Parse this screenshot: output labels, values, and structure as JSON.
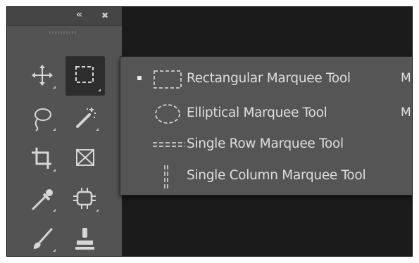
{
  "header": {
    "collapse_glyph": "«",
    "close_glyph": "✖"
  },
  "tools": [
    {
      "icon": "move-icon"
    },
    {
      "icon": "rectangular-marquee-icon",
      "active": true
    },
    {
      "icon": "lasso-icon"
    },
    {
      "icon": "magic-wand-icon"
    },
    {
      "icon": "crop-icon"
    },
    {
      "icon": "frame-icon"
    },
    {
      "icon": "eyedropper-icon"
    },
    {
      "icon": "spot-healing-icon"
    },
    {
      "icon": "brush-icon"
    },
    {
      "icon": "clone-stamp-icon"
    }
  ],
  "flyout": {
    "items": [
      {
        "label": "Rectangular Marquee Tool",
        "shortcut": "M",
        "selected": true,
        "icon": "rectangular-marquee-icon"
      },
      {
        "label": "Elliptical Marquee Tool",
        "shortcut": "M",
        "selected": false,
        "icon": "elliptical-marquee-icon"
      },
      {
        "label": "Single Row Marquee Tool",
        "shortcut": "",
        "selected": false,
        "icon": "single-row-marquee-icon"
      },
      {
        "label": "Single Column Marquee Tool",
        "shortcut": "",
        "selected": false,
        "icon": "single-column-marquee-icon"
      }
    ]
  },
  "colors": {
    "toolbar_bg": "#535353",
    "menu_bg": "#555555",
    "canvas_bg": "#1b1b1b",
    "icon": "#d6d6d6",
    "text": "#dedede"
  }
}
